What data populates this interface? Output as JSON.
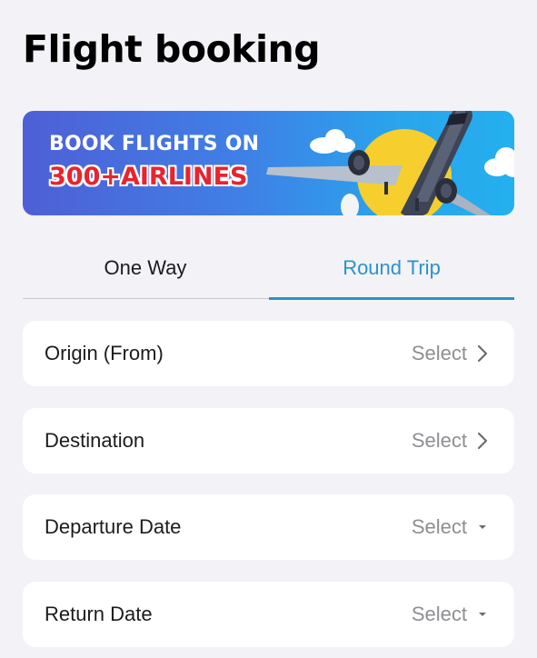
{
  "page": {
    "title": "Flight booking"
  },
  "banner": {
    "line1": "BOOK FLIGHTS ON",
    "line2": "300+AIRLINES"
  },
  "tabs": [
    {
      "label": "One Way",
      "active": false
    },
    {
      "label": "Round Trip",
      "active": true
    }
  ],
  "form": {
    "rows": [
      {
        "label": "Origin (From)",
        "value": "Select",
        "icon": "chevron-right-icon"
      },
      {
        "label": "Destination",
        "value": "Select",
        "icon": "chevron-right-icon"
      },
      {
        "label": "Departure Date",
        "value": "Select",
        "icon": "caret-down-icon"
      },
      {
        "label": "Return Date",
        "value": "Select",
        "icon": "caret-down-icon"
      }
    ]
  },
  "colors": {
    "accent": "#2a93c9",
    "background": "#f2f2f7",
    "banner_red": "#e8242f"
  }
}
